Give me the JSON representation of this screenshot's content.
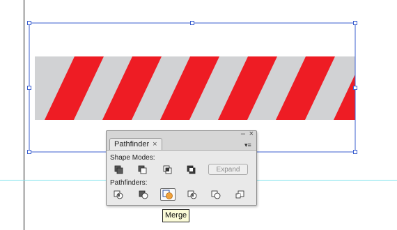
{
  "artwork": {
    "band_color": "#d1d2d4",
    "stripe_color": "#ee1c24",
    "selection_color": "#3b5fcf",
    "guide_color": "#7fe3ec",
    "stripe_count": 6
  },
  "panel": {
    "tab_label": "Pathfinder",
    "tab_close_glyph": "×",
    "collapse_glyph": "–",
    "close_glyph": "×",
    "menu_glyph": "▾≡",
    "shape_modes": {
      "label": "Shape Modes:",
      "buttons": [
        "unite-icon",
        "minus-front-icon",
        "intersect-icon",
        "exclude-icon"
      ],
      "expand_label": "Expand"
    },
    "pathfinders": {
      "label": "Pathfinders:",
      "buttons": [
        "divide-icon",
        "trim-icon",
        "merge-icon",
        "crop-icon",
        "outline-icon",
        "minus-back-icon"
      ],
      "active": "merge-icon"
    }
  },
  "tooltip": {
    "text": "Merge"
  }
}
